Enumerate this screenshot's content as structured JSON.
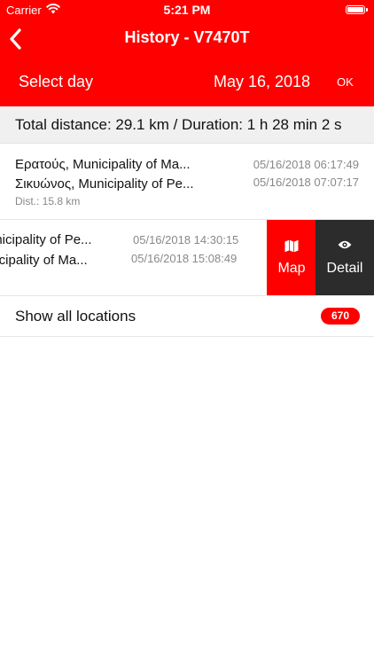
{
  "status_bar": {
    "carrier": "Carrier",
    "time": "5:21 PM"
  },
  "nav": {
    "title": "History - V7470T",
    "back_icon": "chevron-left-icon"
  },
  "date_bar": {
    "select_label": "Select day",
    "date": "May 16, 2018",
    "ok_label": "OK"
  },
  "summary": {
    "text": "Total distance: 29.1 km / Duration: 1 h 28 min 2 s"
  },
  "trips": [
    {
      "start_location": "Ερατούς, Municipality of Ma...",
      "end_location": "Σικυώνος, Municipality of Pe...",
      "start_time": "05/16/2018 06:17:49",
      "end_time": "05/16/2018 07:07:17",
      "distance": "Dist.: 15.8 km"
    },
    {
      "start_location": "unicipality of Pe...",
      "end_location": "nicipality of Ma...",
      "start_time": "05/16/2018 14:30:15",
      "end_time": "05/16/2018 15:08:49"
    }
  ],
  "swipe_actions": {
    "map_label": "Map",
    "detail_label": "Detail"
  },
  "show_all": {
    "label": "Show all locations",
    "count": "670"
  },
  "colors": {
    "brand_red": "#fe0000",
    "dark_action": "#2c2c2c",
    "summary_bg": "#f0f0f0",
    "muted_text": "#888888"
  }
}
